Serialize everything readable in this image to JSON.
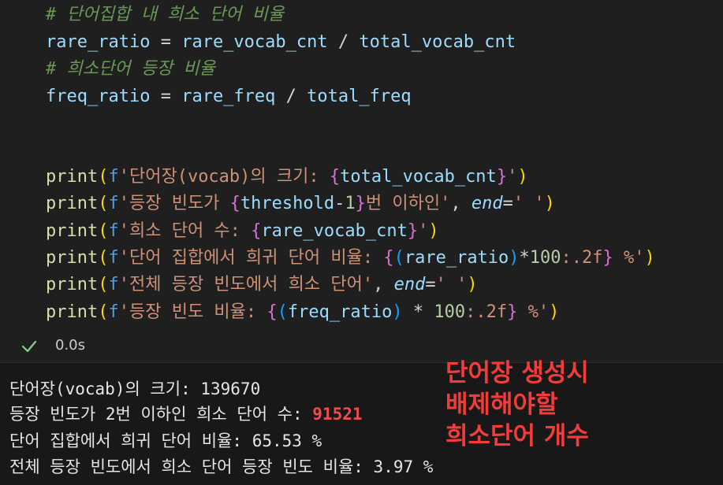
{
  "code": {
    "comment1": "# 단어집합 내 희소 단어 비율",
    "line_rare_ratio": {
      "lhs": "rare_ratio",
      "eq": " = ",
      "a": "rare_vocab_cnt",
      "op": " / ",
      "b": "total_vocab_cnt"
    },
    "comment2": "# 희소단어 등장 비율",
    "line_freq_ratio": {
      "lhs": "freq_ratio",
      "eq": " = ",
      "a": "rare_freq",
      "op": " / ",
      "b": "total_freq"
    },
    "prints": {
      "p1": {
        "fn": "print",
        "open": "(",
        "f": "f",
        "s1": "'단어장(vocab)의 크기: ",
        "lb": "{",
        "v": "total_vocab_cnt",
        "rb": "}",
        "s2": "'",
        "close": ")"
      },
      "p2": {
        "fn": "print",
        "open": "(",
        "f": "f",
        "s1": "'등장 빈도가 ",
        "lb": "{",
        "v": "threshold",
        "minus": "-",
        "n": "1",
        "rb": "}",
        "s2": "번 이하인'",
        "comma": ", ",
        "kw": "end",
        "eq": "=",
        "s3": "' '",
        "close": ")"
      },
      "p3": {
        "fn": "print",
        "open": "(",
        "f": "f",
        "s1": "'희소 단어 수: ",
        "lb": "{",
        "v": "rare_vocab_cnt",
        "rb": "}",
        "s2": "'",
        "close": ")"
      },
      "p4": {
        "fn": "print",
        "open": "(",
        "f": "f",
        "s1": "'단어 집합에서 희귀 단어 비율: ",
        "lb": "{",
        "lp": "(",
        "v": "rare_ratio",
        "rp": ")",
        "mul": "*",
        "n": "100",
        "fmt": ":.2f",
        "rb": "}",
        "s2": " %'",
        "close": ")"
      },
      "p5": {
        "fn": "print",
        "open": "(",
        "f": "f",
        "s1": "'전체 등장 빈도에서 희소 단어'",
        "comma": ", ",
        "kw": "end",
        "eq": "=",
        "s3": "' '",
        "close": ")"
      },
      "p6": {
        "fn": "print",
        "open": "(",
        "f": "f",
        "s1": "'등장 빈도 비율: ",
        "lb": "{",
        "lp": "(",
        "v": "freq_ratio",
        "rp": ")",
        "mul": " * ",
        "n": "100",
        "fmt": ":.2f",
        "rb": "}",
        "s2": " %'",
        "close": ")"
      }
    }
  },
  "status": {
    "icon": "check-icon",
    "time": "0.0s",
    "color": "#89d185"
  },
  "output": {
    "line1": "단어장(vocab)의 크기: 139670",
    "line2_prefix": "등장 빈도가 2번 이하인 희소 단어 수: ",
    "line2_value": "91521",
    "line3": "단어 집합에서 희귀 단어 비율: 65.53 %",
    "line4": "전체 등장 빈도에서 희소 단어 등장 빈도 비율: 3.97 %"
  },
  "annotation": {
    "text": "단어장 생성시\n배제해야할\n희소단어 개수",
    "color": "#f23c3c"
  }
}
